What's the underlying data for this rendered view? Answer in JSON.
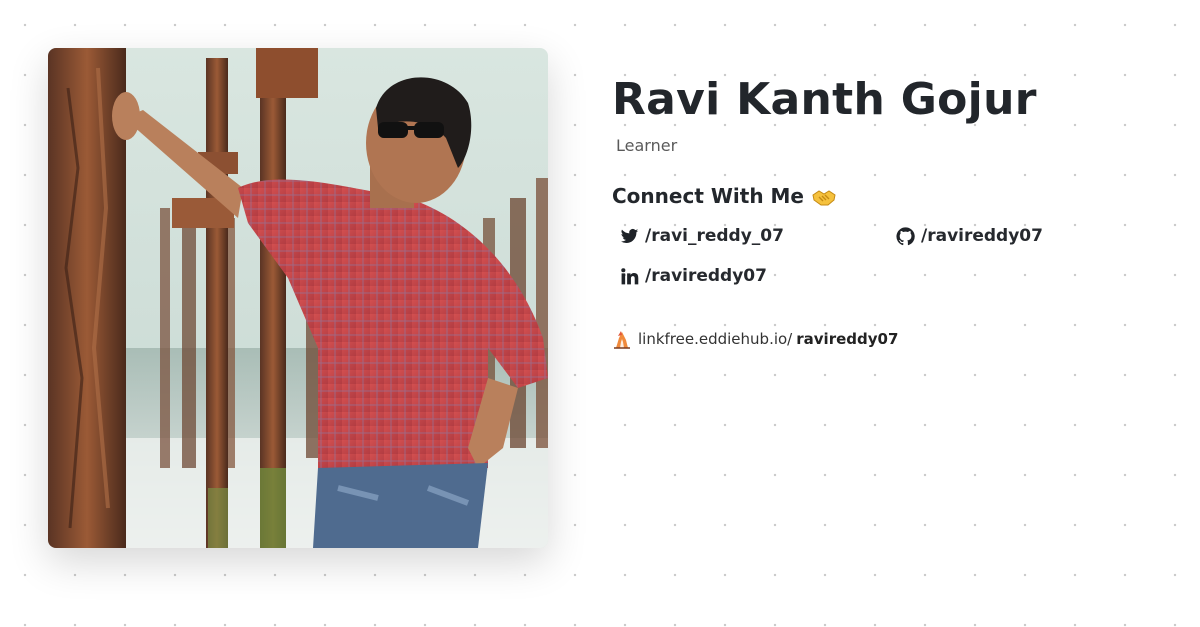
{
  "profile": {
    "name": "Ravi Kanth Gojur",
    "tagline": "Learner"
  },
  "connect": {
    "heading": "Connect With Me",
    "emoji_icon": "handshake-icon"
  },
  "socials": [
    {
      "icon": "twitter-icon",
      "label": "/ravi_reddy_07"
    },
    {
      "icon": "github-icon",
      "label": "/ravireddy07"
    },
    {
      "icon": "linkedin-icon",
      "label": "/ravireddy07"
    }
  ],
  "linkfree": {
    "icon": "linkfree-logo-icon",
    "prefix": "linkfree.eddiehub.io/",
    "username": "ravireddy07"
  },
  "colors": {
    "text": "#22262b",
    "muted": "#5a5a5a",
    "shirt": "#c4474a",
    "rust": "#8a4a2c"
  }
}
